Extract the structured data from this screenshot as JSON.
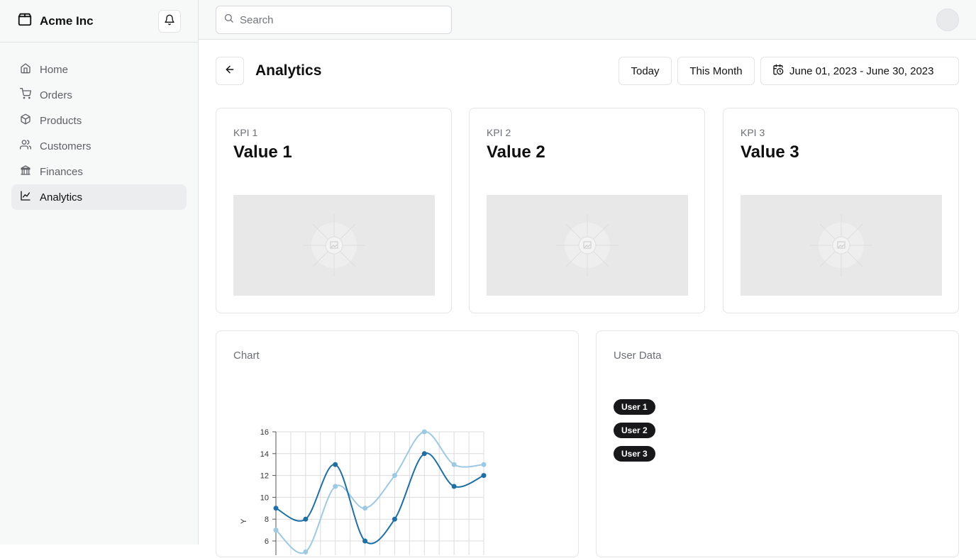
{
  "sidebar": {
    "brand": "Acme Inc",
    "items": [
      {
        "label": "Home"
      },
      {
        "label": "Orders"
      },
      {
        "label": "Products"
      },
      {
        "label": "Customers"
      },
      {
        "label": "Finances"
      },
      {
        "label": "Analytics"
      }
    ],
    "active": "Analytics"
  },
  "topbar": {
    "search_placeholder": "Search"
  },
  "header": {
    "title": "Analytics",
    "today_label": "Today",
    "month_label": "This Month",
    "date_range": "June 01, 2023 - June 30, 2023"
  },
  "kpis": [
    {
      "label": "KPI 1",
      "value": "Value 1"
    },
    {
      "label": "KPI 2",
      "value": "Value 2"
    },
    {
      "label": "KPI 3",
      "value": "Value 3"
    }
  ],
  "chart_card": {
    "title": "Chart"
  },
  "user_card": {
    "title": "User Data",
    "users": [
      "User 1",
      "User 2",
      "User 3"
    ]
  },
  "chart_data": {
    "type": "line",
    "ylabel": "Y",
    "x": [
      0,
      1,
      2,
      3,
      4,
      5,
      6,
      7
    ],
    "ylim": [
      6,
      16
    ],
    "yticks": [
      6,
      8,
      10,
      12,
      14,
      16
    ],
    "series": [
      {
        "color": "#9ec9e2",
        "values": [
          7,
          5,
          11,
          9,
          12,
          16,
          13,
          13
        ]
      },
      {
        "color": "#1f6fa5",
        "values": [
          9,
          8,
          13,
          6,
          8,
          14,
          11,
          12
        ]
      }
    ]
  },
  "colors": {
    "accent": "#1f6fa5",
    "accent_light": "#9ec9e2",
    "badge": "#18181b"
  }
}
